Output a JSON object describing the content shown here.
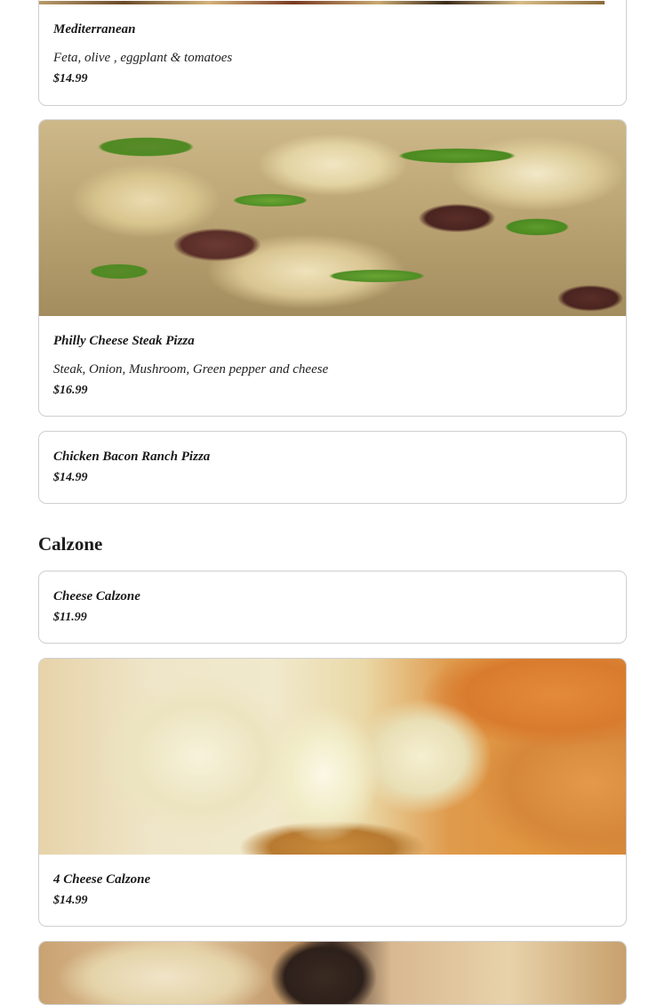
{
  "menu": {
    "items_top": [
      {
        "name": "Mediterranean",
        "description": "Feta, olive , eggplant & tomatoes",
        "price": "$14.99"
      },
      {
        "name": "Philly Cheese Steak Pizza",
        "description": "Steak, Onion, Mushroom, Green pepper and cheese",
        "price": "$16.99"
      },
      {
        "name": "Chicken Bacon Ranch Pizza",
        "price": "$14.99"
      }
    ],
    "calzone_section": {
      "title": "Calzone",
      "items": [
        {
          "name": "Cheese Calzone",
          "price": "$11.99"
        },
        {
          "name": "4 Cheese Calzone",
          "price": "$14.99"
        }
      ]
    }
  },
  "colors": {
    "border": "#cfcfcf",
    "text": "#1a1a1a",
    "background": "#ffffff"
  }
}
